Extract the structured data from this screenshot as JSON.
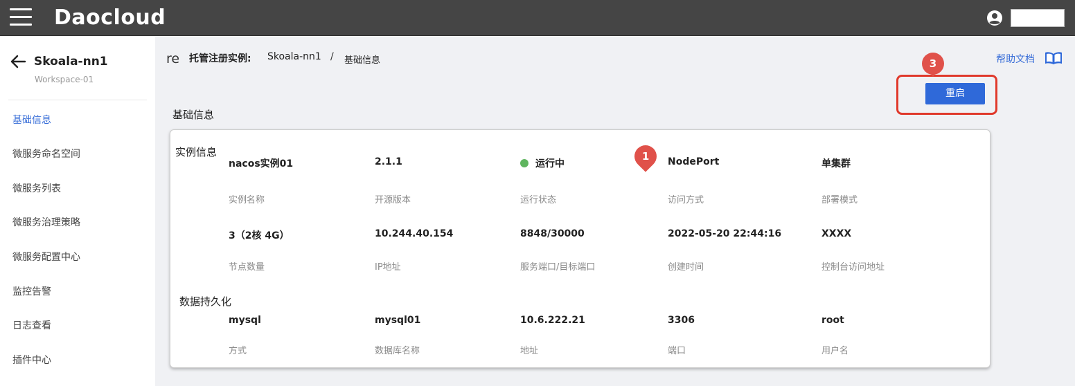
{
  "app": {
    "brand": "Daocloud"
  },
  "sidebar": {
    "title": "Skoala-nn1",
    "subtitle": "Workspace-01",
    "items": [
      {
        "label": "基础信息",
        "active": true
      },
      {
        "label": "微服务命名空间",
        "active": false
      },
      {
        "label": "微服务列表",
        "active": false
      },
      {
        "label": "微服务治理策略",
        "active": false
      },
      {
        "label": "微服务配置中心",
        "active": false
      },
      {
        "label": "监控告警",
        "active": false
      },
      {
        "label": "日志查看",
        "active": false
      },
      {
        "label": "插件中心",
        "active": false
      }
    ]
  },
  "header": {
    "re_fragment": "re",
    "breadcrumb_label": "托管注册实例:",
    "breadcrumb_instance": "Skoala-nn1",
    "breadcrumb_separator": "/",
    "breadcrumb_current": "基础信息",
    "help_label": "帮助文档",
    "help_icon": "book-icon"
  },
  "actions": {
    "restart_label": "重启"
  },
  "annotations": {
    "marker_restart": "3",
    "marker_access": "1",
    "marker_color": "#e0514a",
    "highlight_color": "#e0392b"
  },
  "section": {
    "title": "基础信息"
  },
  "instance_info": {
    "group_title": "实例信息",
    "row1": [
      {
        "value": "nacos实例01",
        "label": "实例名称"
      },
      {
        "value": "2.1.1",
        "label": "开源版本"
      },
      {
        "value": "运行中",
        "label": "运行状态",
        "status_color": "#5fb55f"
      },
      {
        "value": "NodePort",
        "label": "访问方式"
      },
      {
        "value": "单集群",
        "label": "部署模式"
      }
    ],
    "row2": [
      {
        "value": "3（2核 4G）",
        "label": "节点数量"
      },
      {
        "value": "10.244.40.154",
        "label": "IP地址"
      },
      {
        "value": "8848/30000",
        "label": "服务端口/目标端口"
      },
      {
        "value": "2022-05-20 22:44:16",
        "label": "创建时间"
      },
      {
        "value": "XXXX",
        "label": "控制台访问地址"
      }
    ]
  },
  "persistence": {
    "group_title": "数据持久化",
    "row": [
      {
        "value": "mysql",
        "label": "方式"
      },
      {
        "value": "mysql01",
        "label": "数据库名称"
      },
      {
        "value": "10.6.222.21",
        "label": "地址"
      },
      {
        "value": "3306",
        "label": "端口"
      },
      {
        "value": "root",
        "label": "用户名"
      }
    ]
  },
  "colors": {
    "topbar": "#454545",
    "accent": "#2f69d9",
    "link": "#3a6fd8"
  }
}
